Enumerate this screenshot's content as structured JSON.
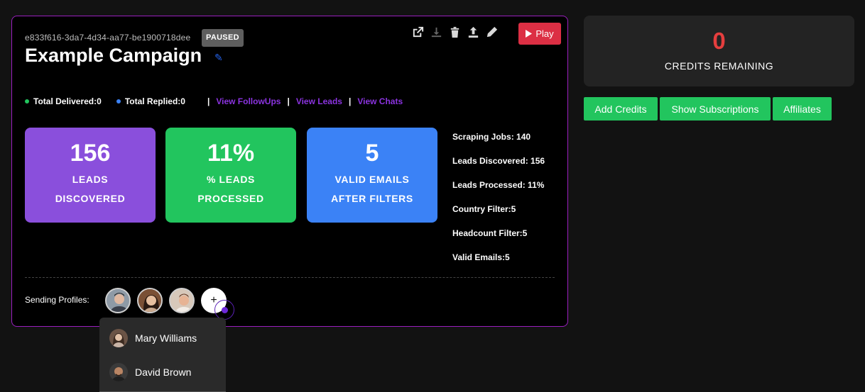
{
  "campaign": {
    "id": "e833f616-3da7-4d34-aa77-be1900718dee",
    "status": "PAUSED",
    "title": "Example Campaign",
    "edit_icon": "pencil-icon",
    "toolbar_icons": [
      "external-link-icon",
      "download-icon",
      "trash-icon",
      "upload-icon",
      "pencil-icon"
    ],
    "play_label": "Play"
  },
  "stats": {
    "delivered_label": "Total Delivered:",
    "delivered_value": "0",
    "replied_label": "Total Replied:",
    "replied_value": "0",
    "separator": "|",
    "links": [
      "View FollowUps",
      "View Leads",
      "View Chats"
    ]
  },
  "metrics": [
    {
      "value": "156",
      "label": "LEADS\nDISCOVERED",
      "color": "#8a4fdc"
    },
    {
      "value": "11%",
      "label": "% LEADS\nPROCESSED",
      "color": "#22c55e"
    },
    {
      "value": "5",
      "label": "VALID EMAILS\nAFTER FILTERS",
      "color": "#3b82f6"
    }
  ],
  "details": [
    {
      "label": "Scraping Jobs:",
      "value": " 140"
    },
    {
      "label": "Leads Discovered:",
      "value": " 156"
    },
    {
      "label": "Leads Processed:",
      "value": " 11%"
    },
    {
      "label": "Country Filter:",
      "value": "5"
    },
    {
      "label": "Headcount Filter:",
      "value": "5"
    },
    {
      "label": "Valid Emails:",
      "value": "5"
    }
  ],
  "profiles": {
    "label": "Sending Profiles:",
    "add_symbol": "+",
    "dropdown": [
      "Mary Williams",
      "David Brown"
    ]
  },
  "credits": {
    "value": "0",
    "label": "CREDITS REMAINING"
  },
  "actions": [
    "Add Credits",
    "Show Subscriptions",
    "Affiliates"
  ],
  "colors": {
    "accent_border": "#9b1fbf",
    "link": "#8b33e0",
    "play": "#dc2f44",
    "credits_value": "#e53e3e",
    "button_green": "#22c55e",
    "delivered_dot": "#22c55e",
    "replied_dot": "#3b82f6"
  }
}
